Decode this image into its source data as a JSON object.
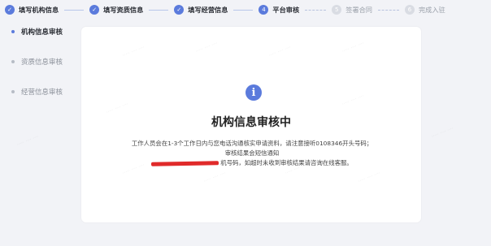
{
  "steps": [
    {
      "num": "✓",
      "label": "填写机构信息",
      "state": "done"
    },
    {
      "num": "✓",
      "label": "填写资质信息",
      "state": "done"
    },
    {
      "num": "✓",
      "label": "填写经营信息",
      "state": "done"
    },
    {
      "num": "4",
      "label": "平台审核",
      "state": "active"
    },
    {
      "num": "5",
      "label": "签署合同",
      "state": "pending"
    },
    {
      "num": "6",
      "label": "完成入驻",
      "state": "pending"
    }
  ],
  "sidenav": [
    {
      "label": "机构信息审核",
      "active": true
    },
    {
      "label": "资质信息审核",
      "active": false
    },
    {
      "label": "经营信息审核",
      "active": false
    }
  ],
  "card": {
    "icon": "info-icon",
    "title": "机构信息审核中",
    "desc_line1": "工作人员会在1-3个工作日内与您电话沟通核实申请资料，请注意接听0108346开头号码；审核结果会短信通知",
    "desc_line2_suffix": "机号码，如超时未收到审核结果请咨询在线客服。"
  },
  "colors": {
    "accent": "#5b7bdc",
    "background": "#f2f3f7",
    "redaction": "#e02a2a"
  }
}
